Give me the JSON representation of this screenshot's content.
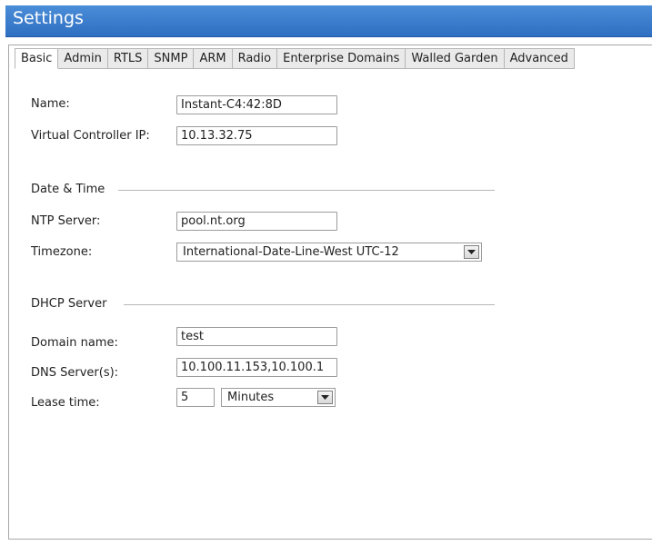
{
  "window": {
    "title": "Settings"
  },
  "tabs": [
    {
      "label": "Basic",
      "active": true
    },
    {
      "label": "Admin"
    },
    {
      "label": "RTLS"
    },
    {
      "label": "SNMP"
    },
    {
      "label": "ARM"
    },
    {
      "label": "Radio"
    },
    {
      "label": "Enterprise Domains"
    },
    {
      "label": "Walled Garden"
    },
    {
      "label": "Advanced"
    }
  ],
  "basic": {
    "name_label": "Name:",
    "name_value": "Instant-C4:42:8D",
    "vc_ip_label": "Virtual Controller IP:",
    "vc_ip_value": "10.13.32.75"
  },
  "date_time": {
    "section_title": "Date & Time",
    "ntp_label": "NTP Server:",
    "ntp_value": "pool.nt.org",
    "timezone_label": "Timezone:",
    "timezone_value": "International-Date-Line-West UTC-12"
  },
  "dhcp": {
    "section_title": "DHCP Server",
    "domain_label": "Domain name:",
    "domain_value": "test",
    "dns_label": "DNS Server(s):",
    "dns_value": "10.100.11.153,10.100.1",
    "lease_label": "Lease time:",
    "lease_value": "5",
    "lease_unit": "Minutes"
  },
  "colors": {
    "title_bar": "#3a7ccd",
    "active_tab": "#ffffff",
    "inactive_tab": "#eaeaea"
  },
  "icons": {
    "dropdown": "chevron-down-icon"
  }
}
